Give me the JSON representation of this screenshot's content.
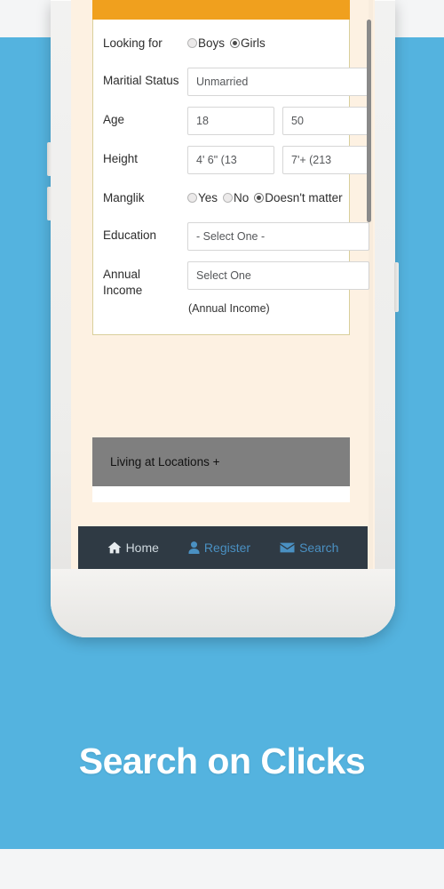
{
  "promo": {
    "caption": "Search on Clicks",
    "background_color": "#54b3df"
  },
  "app": {
    "header_color": "#f0a01e",
    "form": {
      "rows": [
        {
          "label": "Looking for",
          "type": "radio",
          "options": [
            {
              "label": "Boys",
              "selected": false
            },
            {
              "label": "Girls",
              "selected": true
            }
          ]
        },
        {
          "label": "Maritial Status",
          "type": "text",
          "value": "Unmarried"
        },
        {
          "label": "Age",
          "type": "range",
          "from": "18",
          "to": "50"
        },
        {
          "label": "Height",
          "type": "range",
          "from": "4' 6\" (13",
          "to": "7'+ (213"
        },
        {
          "label": "Manglik",
          "type": "radio",
          "options": [
            {
              "label": "Yes",
              "selected": false
            },
            {
              "label": "No",
              "selected": false
            },
            {
              "label": "Doesn't matter",
              "selected": true
            }
          ]
        },
        {
          "label": "Education",
          "type": "select",
          "value": "- Select One -"
        },
        {
          "label": "Annual Income",
          "label_line1": "Annual",
          "label_line2": "Income",
          "type": "select",
          "value": "Select One",
          "hint": "(Annual Income)"
        }
      ]
    },
    "locations_bar": {
      "label": "Living at Locations +",
      "color": "#7f7f7f"
    },
    "nav": {
      "background_color": "#2f3a44",
      "items": [
        {
          "label": "Home",
          "icon": "home-icon",
          "active": true
        },
        {
          "label": "Register",
          "icon": "user-icon",
          "active": false
        },
        {
          "label": "Search",
          "icon": "envelope-icon",
          "active": false
        }
      ]
    }
  }
}
